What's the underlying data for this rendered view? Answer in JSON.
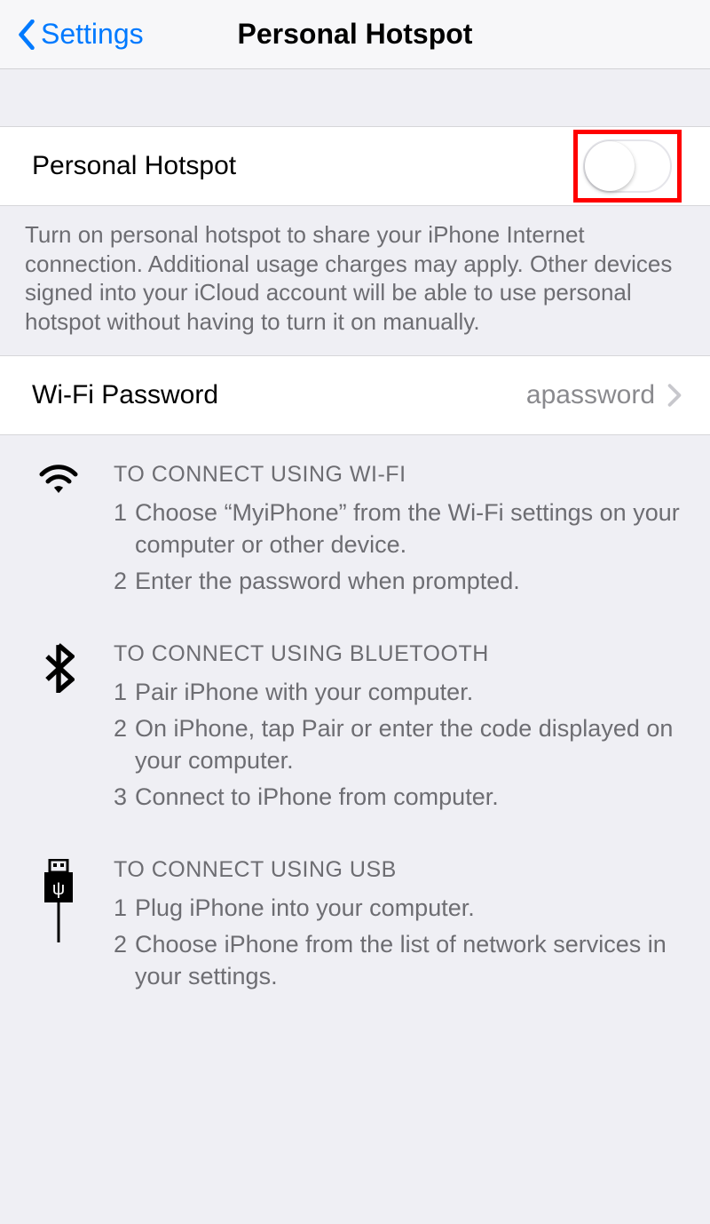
{
  "header": {
    "back_label": "Settings",
    "title": "Personal Hotspot"
  },
  "hotspot_row": {
    "label": "Personal Hotspot",
    "enabled": false
  },
  "hotspot_note": "Turn on personal hotspot to share your iPhone Internet connection. Additional usage charges may apply. Other devices signed into your iCloud account will be able to use personal hotspot without having to turn it on manually.",
  "wifi_password_row": {
    "label": "Wi-Fi Password",
    "value": "apassword"
  },
  "instructions": {
    "wifi": {
      "heading": "TO CONNECT USING WI-FI",
      "steps": [
        "Choose “MyiPhone” from the Wi-Fi settings on your computer or other device.",
        "Enter the password when prompted."
      ]
    },
    "bluetooth": {
      "heading": "TO CONNECT USING BLUETOOTH",
      "steps": [
        "Pair iPhone with your computer.",
        "On iPhone, tap Pair or enter the code displayed on your computer.",
        "Connect to iPhone from computer."
      ]
    },
    "usb": {
      "heading": "TO CONNECT USING USB",
      "steps": [
        "Plug iPhone into your computer.",
        "Choose iPhone from the list of network services in your settings."
      ]
    }
  }
}
